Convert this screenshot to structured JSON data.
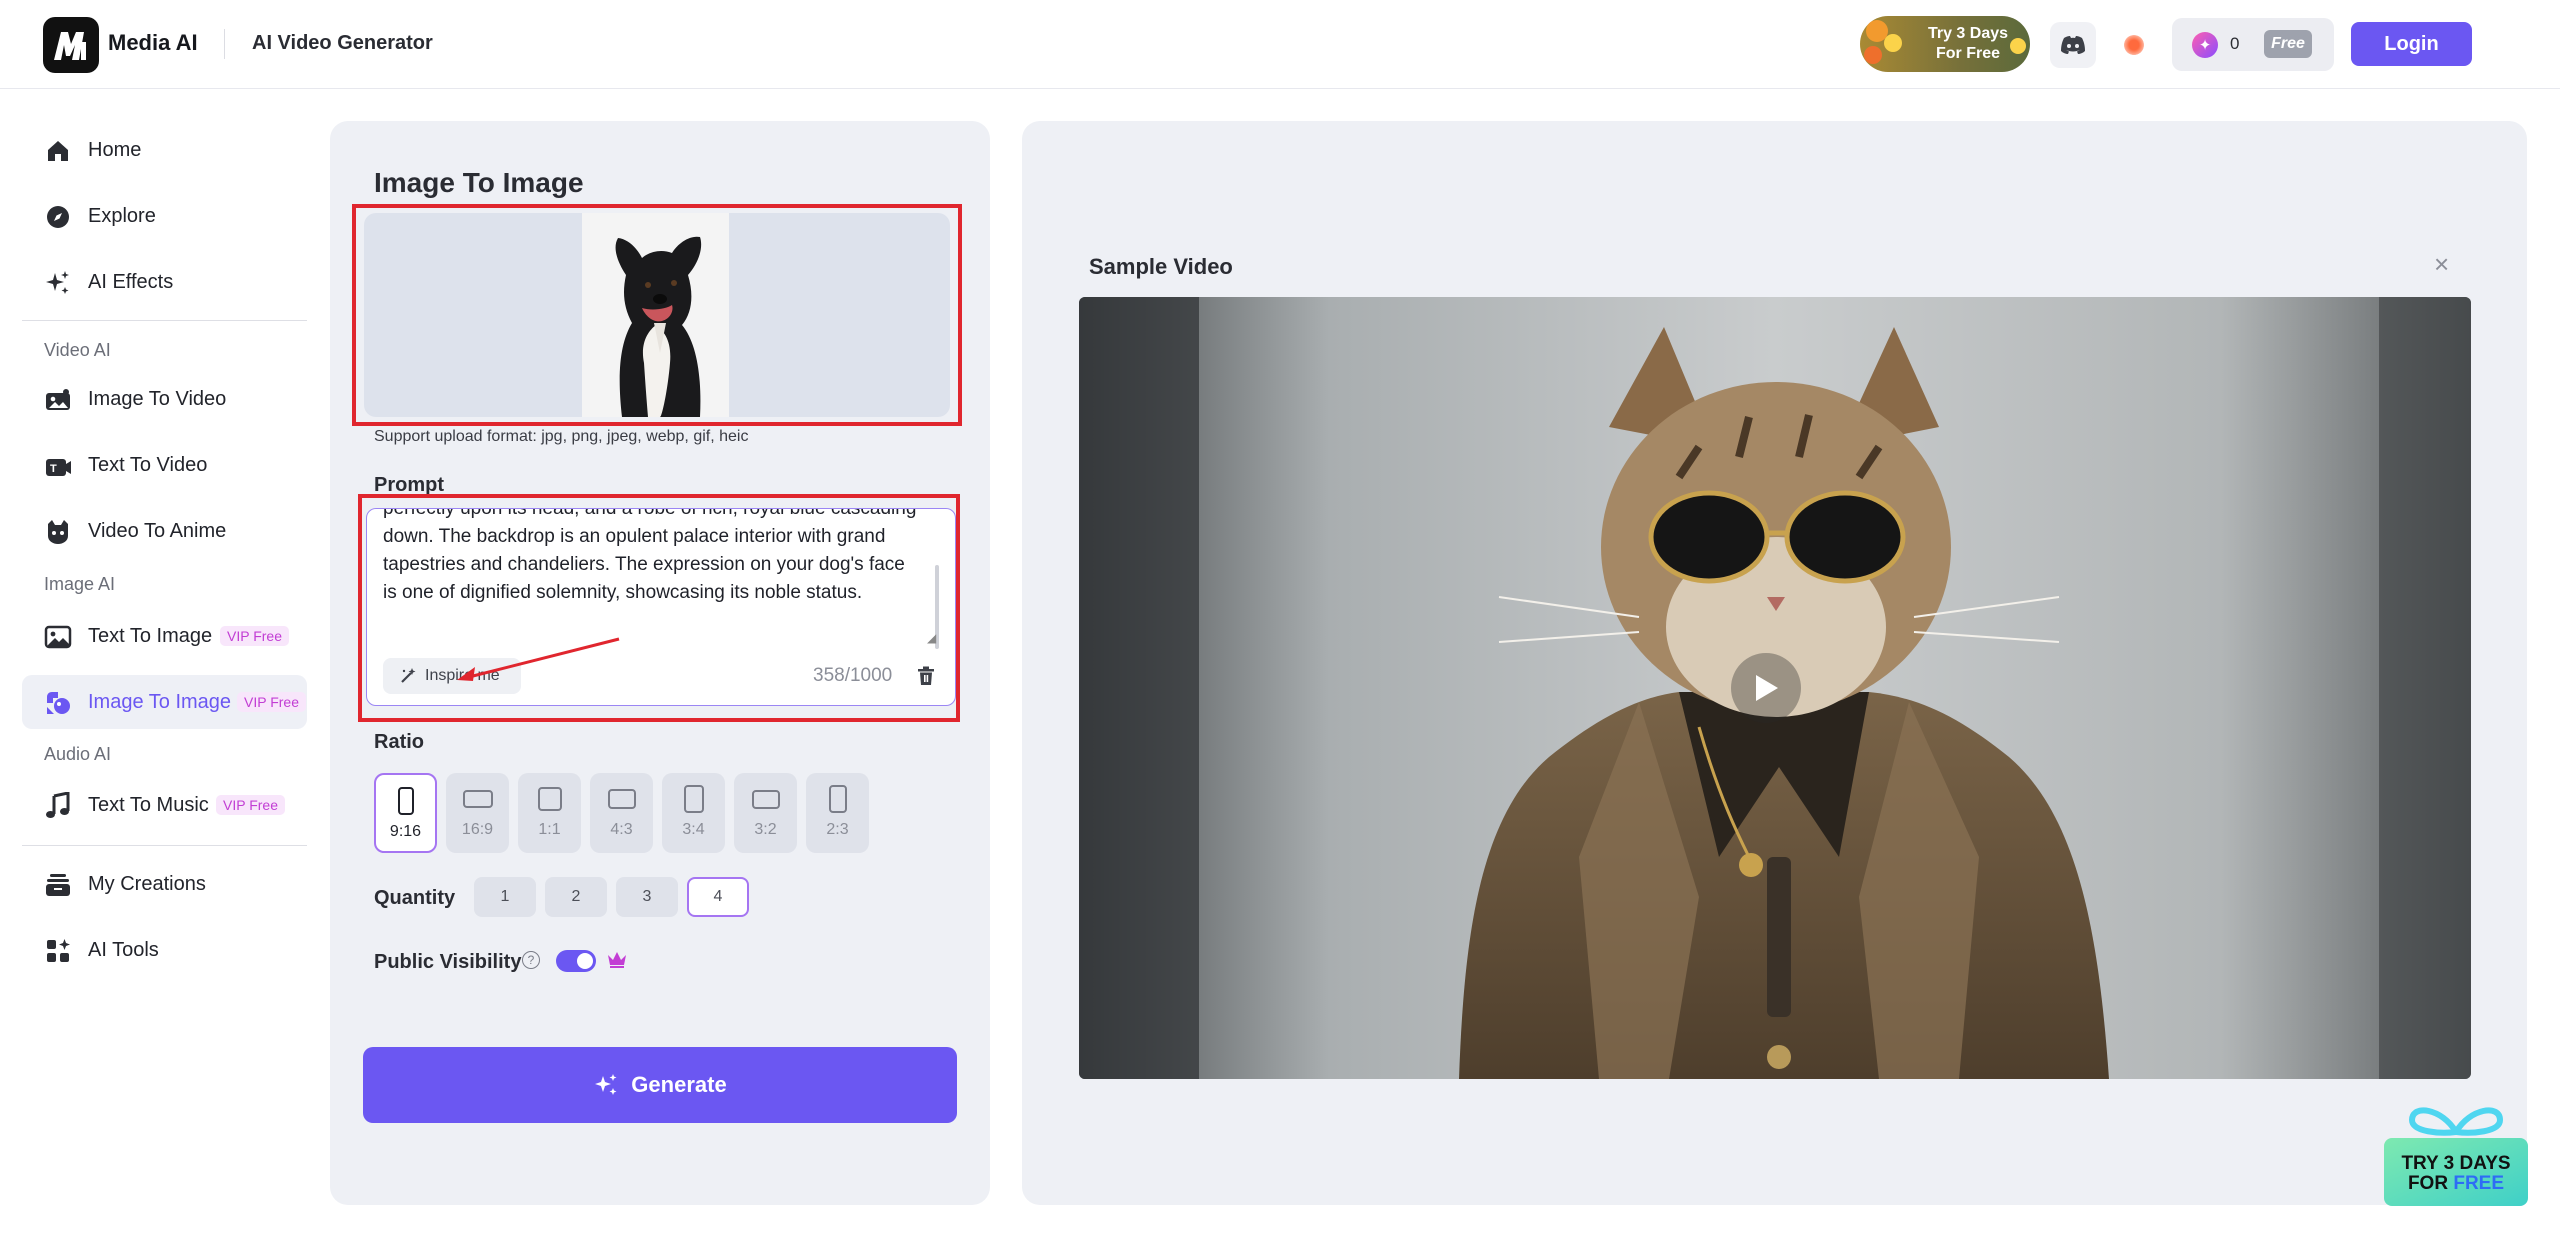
{
  "header": {
    "brand": "Media AI",
    "title": "AI Video Generator",
    "trial": "Try 3 Days For Free",
    "credits": "0",
    "plan": "Free",
    "login": "Login"
  },
  "sidebar": {
    "home": "Home",
    "explore": "Explore",
    "ai_effects": "AI Effects",
    "group_video": "Video AI",
    "image_to_video": "Image To Video",
    "text_to_video": "Text To Video",
    "video_to_anime": "Video To Anime",
    "group_image": "Image AI",
    "text_to_image": "Text To Image",
    "image_to_image": "Image To Image",
    "group_audio": "Audio AI",
    "text_to_music": "Text To Music",
    "vip_badge": "VIP Free",
    "my_creations": "My Creations",
    "ai_tools": "AI Tools"
  },
  "form": {
    "title": "Image To Image",
    "support_text": "Support upload format: jpg, png, jpeg, webp, gif, heic",
    "prompt_label": "Prompt",
    "prompt_text": "perfectly upon its head, and a robe of rich, royal blue cascading down. The backdrop is an opulent palace interior with grand tapestries and chandeliers. The expression on your dog's face is one of dignified solemnity, showcasing its noble status.",
    "inspire": "Inspire me",
    "char_count": "358/1000",
    "ratio_label": "Ratio",
    "ratios": [
      "9:16",
      "16:9",
      "1:1",
      "4:3",
      "3:4",
      "3:2",
      "2:3"
    ],
    "selected_ratio": "9:16",
    "quantity_label": "Quantity",
    "quantities": [
      "1",
      "2",
      "3",
      "4"
    ],
    "selected_quantity": "4",
    "visibility_label": "Public Visibility",
    "visibility_on": true,
    "generate": "Generate"
  },
  "sample": {
    "title": "Sample Video"
  },
  "promo": {
    "line1": "TRY 3 DAYS",
    "line2_a": "FOR ",
    "line2_b": "FREE"
  },
  "colors": {
    "accent": "#6b57f2",
    "highlight_frame": "#e0262e",
    "vip_text": "#c23ed4"
  }
}
